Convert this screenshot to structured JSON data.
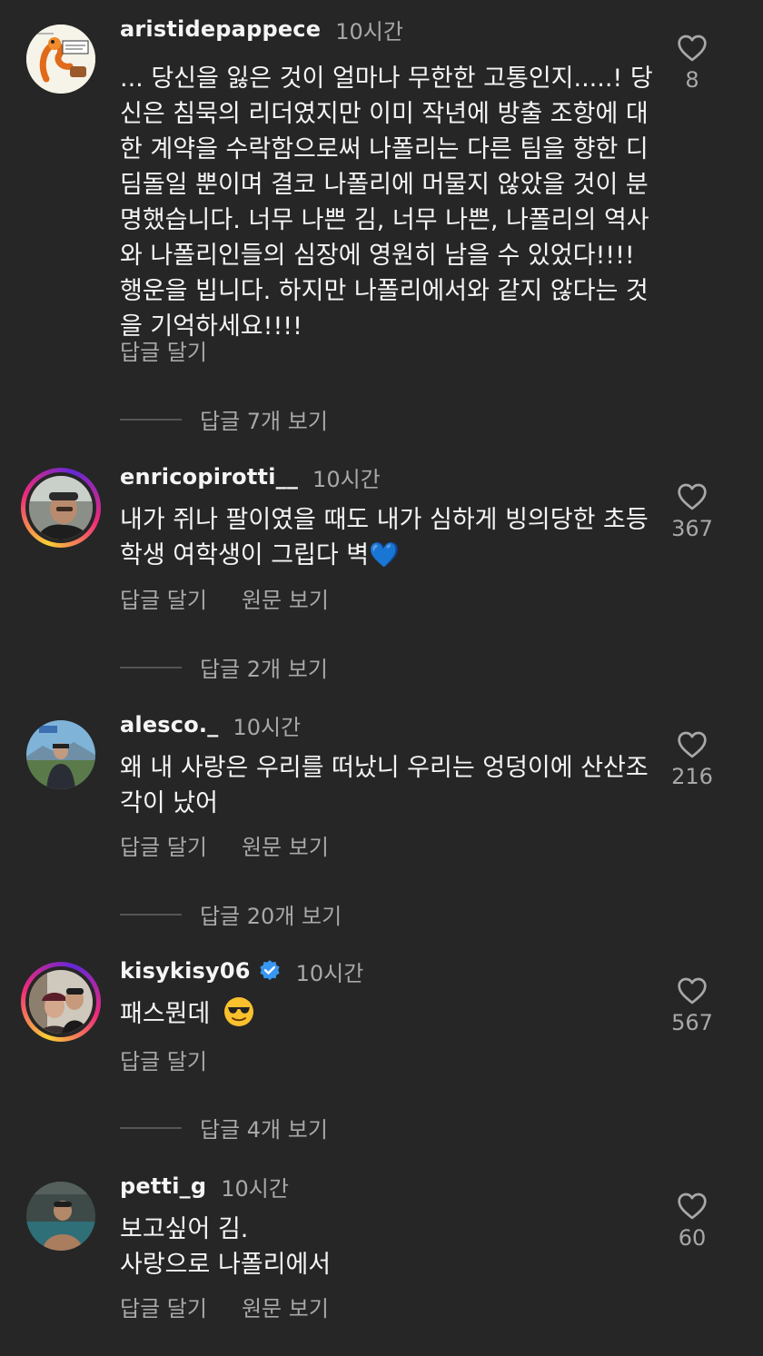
{
  "comments": [
    {
      "username": "aristidepappece",
      "time": "10시간",
      "text": "... 당신을 잃은 것이 얼마나 무한한 고통인지.....! 당신은 침묵의 리더였지만 이미 작년에 방출 조항에 대한 계약을 수락함으로써 나폴리는 다른 팀을 향한 디딤돌일 뿐이며 결코 나폴리에 머물지 않았을 것이 분명했습니다. 너무 나쁜 김, 너무 나쁜, 나폴리의 역사와 나폴리인들의 심장에 영원히 남을 수 있었다!!!! 행운을 빕니다. 하지만 나폴리에서와 같지 않다는 것을 기억하세요!!!!",
      "likes": "8",
      "reply_label": "답글 달기",
      "view_replies": "답글 7개 보기"
    },
    {
      "username": "enricopirotti__",
      "time": "10시간",
      "text": "내가 쥐나 팔이였을 때도 내가 심하게 빙의당한 초등학생 여학생이 그립다 벽",
      "emoji": "💙",
      "likes": "367",
      "reply_label": "답글 달기",
      "translate_label": "원문 보기",
      "view_replies": "답글 2개 보기"
    },
    {
      "username": "alesco._",
      "time": "10시간",
      "text": "왜 내 사랑은 우리를 떠났니 우리는 엉덩이에 산산조각이 났어",
      "likes": "216",
      "reply_label": "답글 달기",
      "translate_label": "원문 보기",
      "view_replies": "답글 20개 보기"
    },
    {
      "username": "kisykisy06",
      "time": "10시간",
      "text": "패스뭔데",
      "emoji": "😎",
      "likes": "567",
      "reply_label": "답글 달기",
      "view_replies": "답글 4개 보기"
    },
    {
      "username": "petti_g",
      "time": "10시간",
      "text_line1": "보고싶어 김.",
      "text_line2": "사랑으로 나폴리에서",
      "likes": "60",
      "reply_label": "답글 달기",
      "translate_label": "원문 보기"
    }
  ],
  "icons": {
    "like": "heart-outline-icon",
    "verified": "verified-badge-icon"
  },
  "colors": {
    "background": "#262626",
    "primary_text": "#f5f5f5",
    "secondary_text": "#a8a8a8",
    "verified": "#3897f0"
  }
}
